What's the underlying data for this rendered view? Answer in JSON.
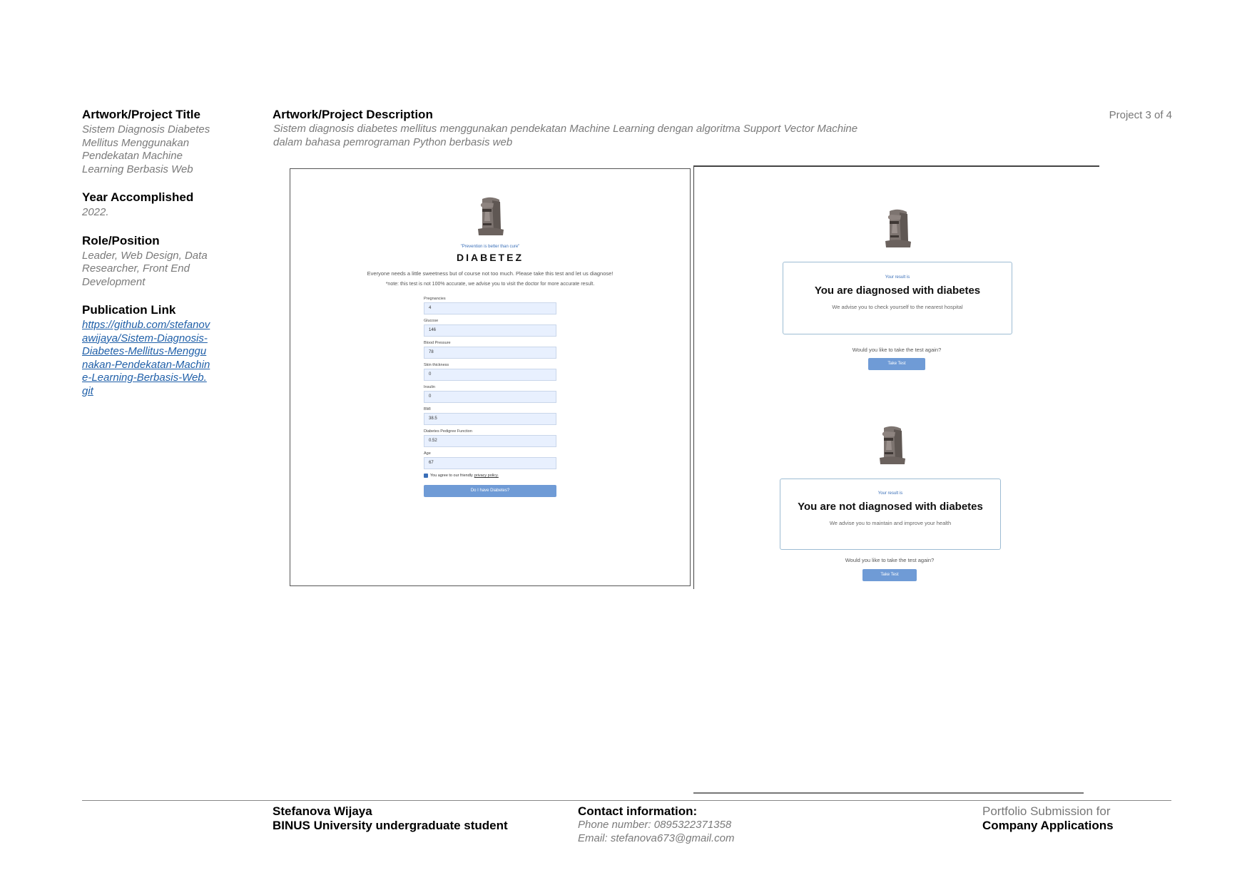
{
  "left": {
    "title_label": "Artwork/Project Title",
    "title_value": "Sistem Diagnosis Diabetes Mellitus Menggunakan Pendekatan Machine Learning Berbasis Web",
    "year_label": "Year Accomplished",
    "year_value": "2022.",
    "role_label": "Role/Position",
    "role_value": "Leader, Web Design, Data Researcher, Front End Development",
    "pub_label": "Publication Link",
    "pub_value": "https://github.com/stefanovawijaya/Sistem-Diagnosis-Diabetes-Mellitus-Menggunakan-Pendekatan-Machine-Learning-Berbasis-Web.git"
  },
  "description": {
    "label": "Artwork/Project Description",
    "text": "Sistem diagnosis diabetes mellitus menggunakan pendekatan Machine Learning dengan algoritma Support Vector Machine dalam bahasa pemrograman Python berbasis web"
  },
  "project_counter": "Project 3 of 4",
  "form_screen": {
    "tagline": "\"Prevention is better than cure\"",
    "brand": "DIABETEZ",
    "intro": "Everyone needs a little sweetness but of course not too much. Please take this test and let us diagnose!",
    "note": "*note: this test is not 100% accurate, we advise you to visit the doctor for more accurate result.",
    "fields": [
      {
        "label": "Pregnancies",
        "value": "4"
      },
      {
        "label": "Glucose",
        "value": "146"
      },
      {
        "label": "Blood Pressure",
        "value": "78"
      },
      {
        "label": "Skin thickness",
        "value": "0"
      },
      {
        "label": "Insulin",
        "value": "0"
      },
      {
        "label": "BMI",
        "value": "38.5"
      },
      {
        "label": "Diabetes Pedigree Function",
        "value": "0.52"
      },
      {
        "label": "Age",
        "value": "67"
      }
    ],
    "agree_text": "You agree to our friendly",
    "agree_link": "privacy policy.",
    "submit": "Do I have Diabetes?"
  },
  "result_positive": {
    "small": "Your result is",
    "title": "You are diagnosed with diabetes",
    "advice": "We advise you to check yourself to the nearest hospital",
    "again": "Would you like to take the test again?",
    "button": "Take Test"
  },
  "result_negative": {
    "small": "Your result is",
    "title": "You are not diagnosed with diabetes",
    "advice": "We advise you to maintain and improve your health",
    "again": "Would you like to take the test again?",
    "button": "Take Test"
  },
  "footer": {
    "name": "Stefanova Wijaya",
    "school": "BINUS University undergraduate student",
    "contact_label": "Contact information:",
    "phone": "Phone number: 0895322371358",
    "email": "Email: stefanova673@gmail.com",
    "portfolio_line1": "Portfolio Submission for",
    "portfolio_line2": "Company Applications"
  },
  "colors": {
    "accent": "#6f9bd6",
    "link": "#1f5fa8",
    "muted": "#7a7a7a"
  },
  "icons": [
    "moai-icon"
  ]
}
